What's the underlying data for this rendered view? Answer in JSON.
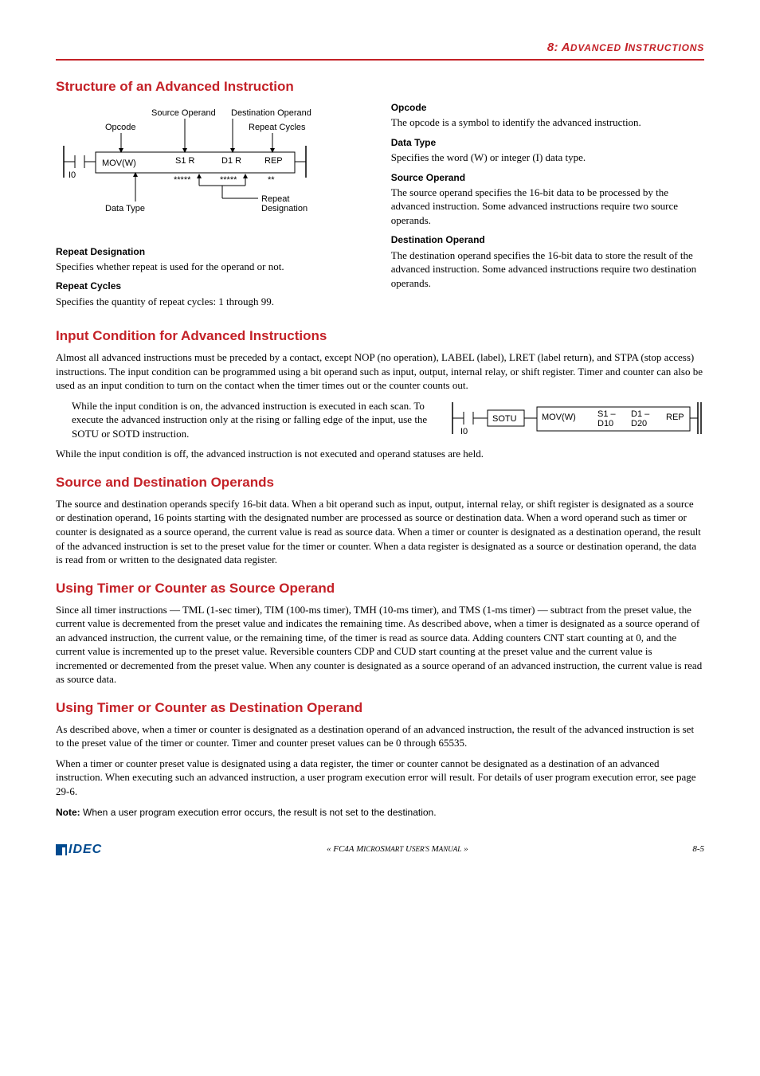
{
  "chapter": {
    "num": "8:",
    "title_a": "A",
    "title_rest": "DVANCED ",
    "title_b": "I",
    "title_rest2": "NSTRUCTIONS"
  },
  "sec1": {
    "title": "Structure of an Advanced Instruction",
    "diagram": {
      "source_operand": "Source Operand",
      "destination_operand": "Destination Operand",
      "opcode": "Opcode",
      "repeat_cycles": "Repeat Cycles",
      "mov": "MOV(W)",
      "s1r": "S1 R",
      "d1r": "D1 R",
      "rep": "REP",
      "i0": "I0",
      "data_type": "Data Type",
      "repeat_designation": "Repeat\nDesignation",
      "stars5": "*****",
      "stars2": "**"
    },
    "opcode_h": "Opcode",
    "opcode_p": "The opcode is a symbol to identify the advanced instruction.",
    "datatype_h": "Data Type",
    "datatype_p": "Specifies the word (W) or integer (I) data type.",
    "srcop_h": "Source Operand",
    "srcop_p": "The source operand specifies the 16-bit data to be processed by the advanced instruction. Some advanced instructions require two source operands.",
    "repdes_h": "Repeat Designation",
    "repdes_p": "Specifies whether repeat is used for the operand or not.",
    "repcyc_h": "Repeat Cycles",
    "repcyc_p": "Specifies the quantity of repeat cycles: 1 through 99.",
    "destop_h": "Destination Operand",
    "destop_p": "The destination operand specifies the 16-bit data to store the result of the advanced instruction. Some advanced instructions require two destination operands."
  },
  "sec2": {
    "title": "Input Condition for Advanced Instructions",
    "p1": "Almost all advanced instructions must be preceded by a contact, except NOP (no operation), LABEL (label), LRET (label return), and STPA (stop access) instructions. The input condition can be programmed using a bit operand such as input, output, internal relay, or shift register. Timer and counter can also be used as an input condition to turn on the contact when the timer times out or the counter counts out.",
    "p2": "While the input condition is on, the advanced instruction is executed in each scan. To execute the advanced instruction only at the rising or falling edge of the input, use the SOTU or SOTD instruction.",
    "p3": "While the input condition is off, the advanced instruction is not executed and operand statuses are held.",
    "ladder": {
      "i0": "I0",
      "sotu": "SOTU",
      "mov": "MOV(W)",
      "s1": "S1 –",
      "d10": "D10",
      "d1": "D1 –",
      "d20": "D20",
      "rep": "REP"
    }
  },
  "sec3": {
    "title": "Source and Destination Operands",
    "p": "The source and destination operands specify 16-bit data. When a bit operand such as input, output, internal relay, or shift register is designated as a source or destination operand, 16 points starting with the designated number are processed as source or destination data. When a word operand such as timer or counter is designated as a source operand, the current value is read as source data. When a timer or counter is designated as a destination operand, the result of the advanced instruction is set to the preset value for the timer or counter. When a data register is designated as a source or destination operand, the data is read from or written to the designated data register."
  },
  "sec4": {
    "title": "Using Timer or Counter as Source Operand",
    "p": "Since all timer instructions — TML (1-sec timer), TIM (100-ms timer), TMH (10-ms timer), and TMS (1-ms timer) — subtract from the preset value, the current value is decremented from the preset value and indicates the remaining time. As described above, when a timer is designated as a source operand of an advanced instruction, the current value, or the remaining time, of the timer is read as source data. Adding counters CNT start counting at 0, and the current value is incremented up to the preset value. Reversible counters CDP and CUD start counting at the preset value and the current value is incremented or decremented from the preset value. When any counter is designated as a source operand of an advanced instruction, the current value is read as source data."
  },
  "sec5": {
    "title": "Using Timer or Counter as Destination Operand",
    "p1": "As described above, when a timer or counter is designated as a destination operand of an advanced instruction, the result of the advanced instruction is set to the preset value of the timer or counter. Timer and counter preset values can be 0 through 65535.",
    "p2": "When a timer or counter preset value is designated using a data register, the timer or counter cannot be designated as a destination of an advanced instruction. When executing such an advanced instruction, a user program execution error will result. For details of user program execution error, see page 29-6.",
    "note_label": "Note:",
    "note": " When a user program execution error occurs, the result is not set to the destination."
  },
  "footer": {
    "manual": "« FC4A MICROSMART USER'S MANUAL »",
    "page": "8-5",
    "idec": "IDEC"
  }
}
